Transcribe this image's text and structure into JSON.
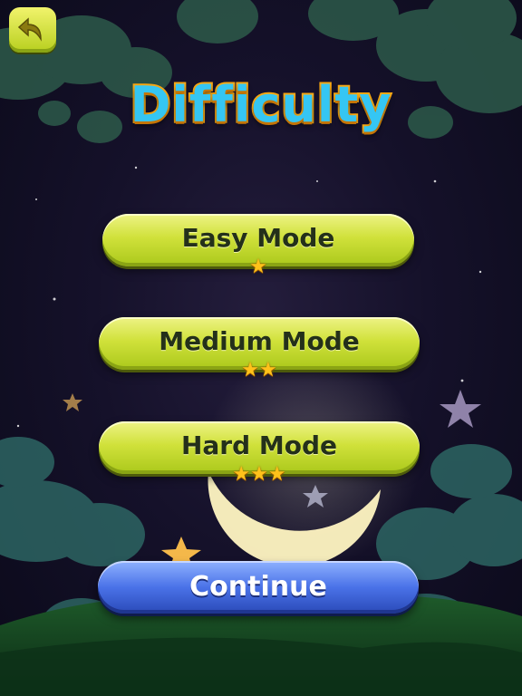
{
  "title": "Difficulty",
  "back_button": {
    "icon": "back-arrow-icon"
  },
  "modes": [
    {
      "label": "Easy Mode",
      "stars": 1
    },
    {
      "label": "Medium Mode",
      "stars": 2
    },
    {
      "label": "Hard Mode",
      "stars": 3
    }
  ],
  "continue_label": "Continue",
  "colors": {
    "title_fill": "#35c6f3",
    "title_outline": "#f7a814",
    "mode_button": "#c8dc32",
    "continue_button": "#4a72e8",
    "star": "#ffc21a",
    "night_sky": "#15112a"
  }
}
